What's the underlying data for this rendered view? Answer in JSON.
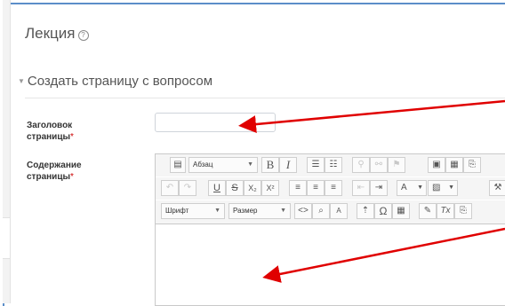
{
  "page": {
    "title": "Лекция",
    "help_icon": "?"
  },
  "section": {
    "collapse_icon": "triangle-down",
    "title": "Создать страницу с вопросом"
  },
  "form": {
    "page_title_label_line1": "Заголовок",
    "page_title_label_line2": "страницы",
    "page_title_required": "*",
    "page_title_value": "",
    "content_label_line1": "Содержание",
    "content_label_line2": "страницы",
    "content_required": "*"
  },
  "editor": {
    "paragraph_select": "Абзац",
    "font_select": "Шрифт",
    "size_select": "Размер",
    "bold": "B",
    "italic": "I",
    "underline": "U",
    "strike": "S",
    "subscript": "X₂",
    "superscript": "X²",
    "omega": "Ω",
    "clear_format": "Tx"
  },
  "annotations": {
    "arrow_color": "#e00000"
  }
}
